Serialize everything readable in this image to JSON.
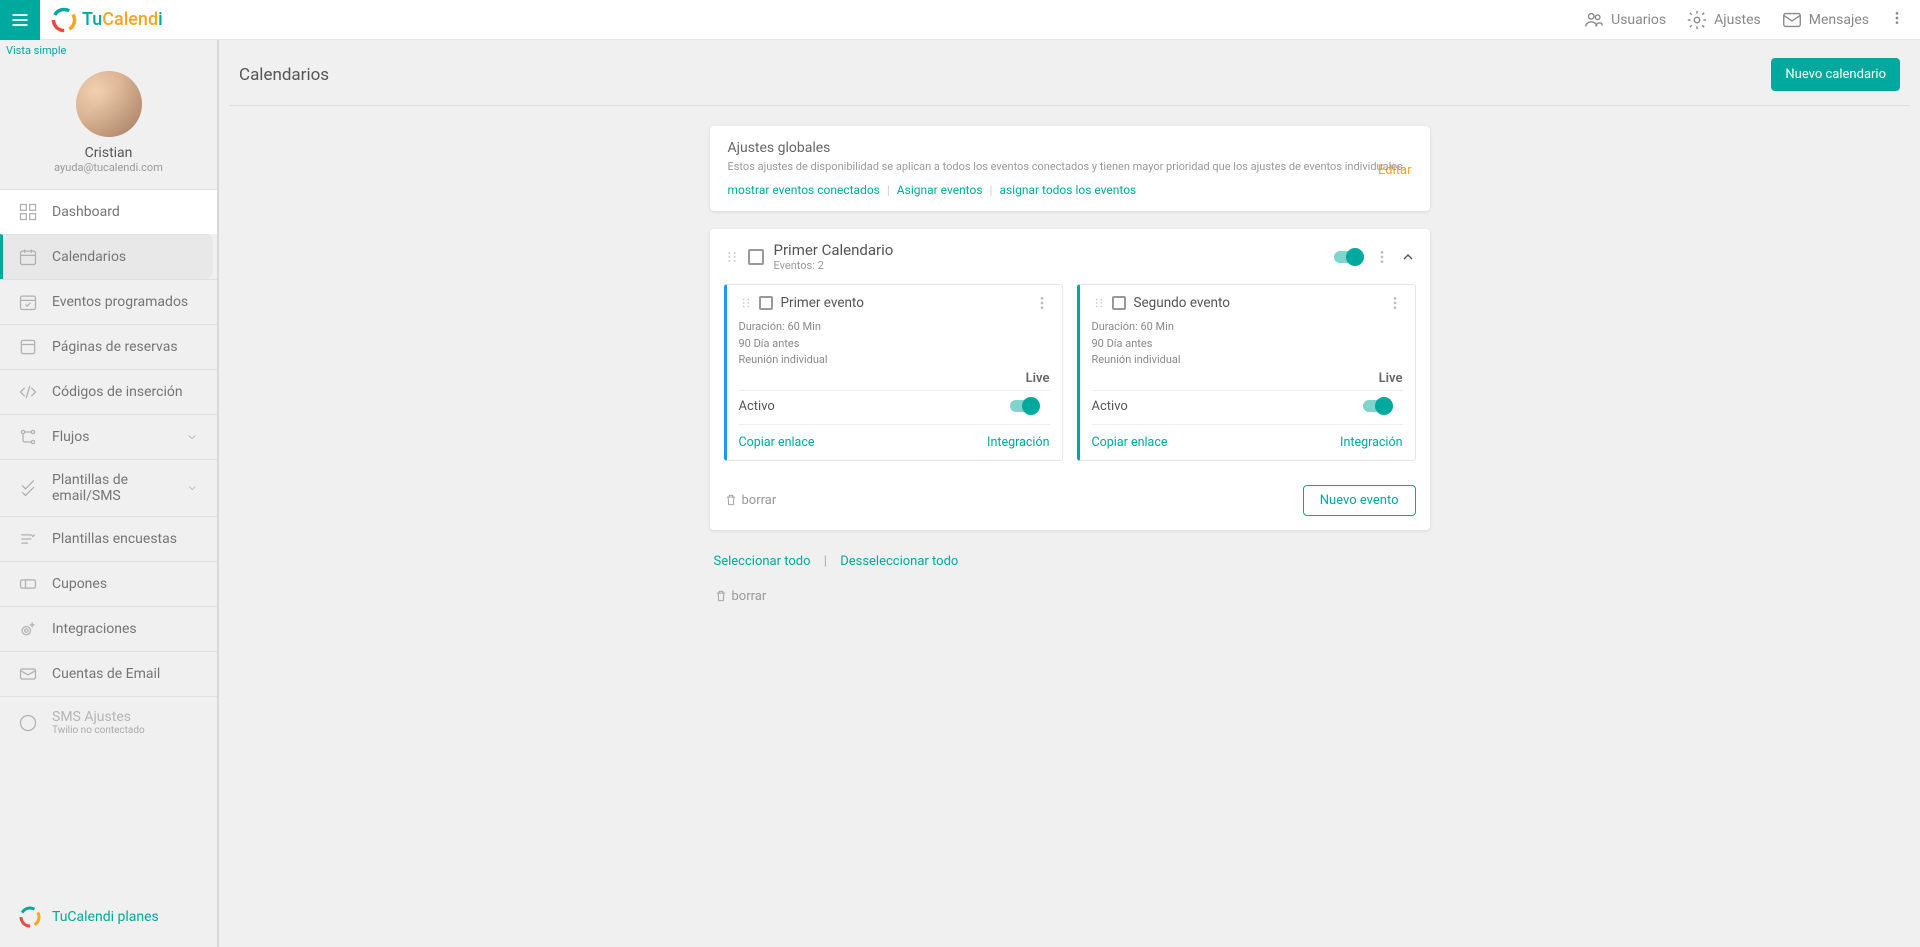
{
  "brand": {
    "part1": "Tu",
    "part2": "Calend",
    "part3": "i"
  },
  "header": {
    "users": "Usuarios",
    "settings": "Ajustes",
    "messages": "Mensajes"
  },
  "sidebar": {
    "vista_simple": "Vista simple",
    "profile_name": "Cristian",
    "profile_email": "ayuda@tucalendi.com",
    "items": {
      "dashboard": "Dashboard",
      "calendars": "Calendarios",
      "scheduled": "Eventos programados",
      "booking": "Páginas de reservas",
      "embed": "Códigos de inserción",
      "flows": "Flujos",
      "templates": "Plantillas de email/SMS",
      "surveys": "Plantillas encuestas",
      "coupons": "Cupones",
      "integrations": "Integraciones",
      "email_accounts": "Cuentas de Email",
      "sms": "SMS Ajustes",
      "sms_sub": "Twilio no contectado"
    },
    "footer": "TuCalendi planes"
  },
  "page": {
    "title": "Calendarios",
    "new_calendar": "Nuevo calendario"
  },
  "global": {
    "title": "Ajustes globales",
    "desc": "Estos ajustes de disponibilidad se aplican a todos los eventos conectados y tienen mayor prioridad que los ajustes de eventos individuales.",
    "show_connected": "mostrar eventos conectados",
    "assign": "Asignar eventos",
    "assign_all": "asignar todos los eventos",
    "edit": "Editar"
  },
  "calendar": {
    "name": "Primer Calendario",
    "events_label": "Eventos: 2",
    "delete": "borrar",
    "new_event": "Nuevo evento"
  },
  "events": [
    {
      "name": "Primer evento",
      "duration": "Duración: 60 Min",
      "days": "90 Día antes",
      "type": "Reunión individual",
      "live": "Live",
      "active": "Activo",
      "copy": "Copiar enlace",
      "integration": "Integración"
    },
    {
      "name": "Segundo evento",
      "duration": "Duración: 60 Min",
      "days": "90 Día antes",
      "type": "Reunión individual",
      "live": "Live",
      "active": "Activo",
      "copy": "Copiar enlace",
      "integration": "Integración"
    }
  ],
  "selection": {
    "select_all": "Seleccionar todo",
    "deselect_all": "Desseleccionar todo",
    "delete": "borrar"
  }
}
